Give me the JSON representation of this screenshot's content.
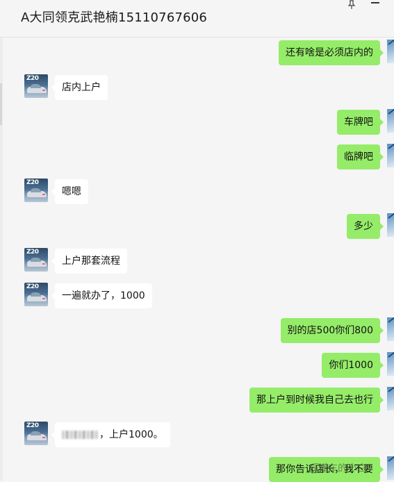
{
  "window": {
    "title": "A大同领克武艳楠15110767606",
    "pin_icon": "pin-icon",
    "minimize_icon": "minimize-icon"
  },
  "contact_avatar": {
    "icon": "car-avatar",
    "badge_text": "Z20"
  },
  "messages": [
    {
      "side": "out",
      "text": "还有啥是必须店内的"
    },
    {
      "side": "in",
      "text": "店内上户"
    },
    {
      "side": "out",
      "text": "车牌吧"
    },
    {
      "side": "out",
      "text": "临牌吧"
    },
    {
      "side": "in",
      "text": "嗯嗯"
    },
    {
      "side": "out",
      "text": "多少"
    },
    {
      "side": "in",
      "text": "上户那套流程"
    },
    {
      "side": "in",
      "text": "一遍就办了，1000"
    },
    {
      "side": "out",
      "text": "别的店500你们800"
    },
    {
      "side": "out",
      "text": "你们1000"
    },
    {
      "side": "out",
      "text": "那上户到时候我自己去也行"
    },
    {
      "side": "in",
      "text": "，上户1000。",
      "redacted_prefix": true
    },
    {
      "side": "out",
      "text": "那你告诉店长，我不要"
    }
  ],
  "watermark": {
    "text": "@懂车的小白",
    "icon": "weibo-icon"
  }
}
